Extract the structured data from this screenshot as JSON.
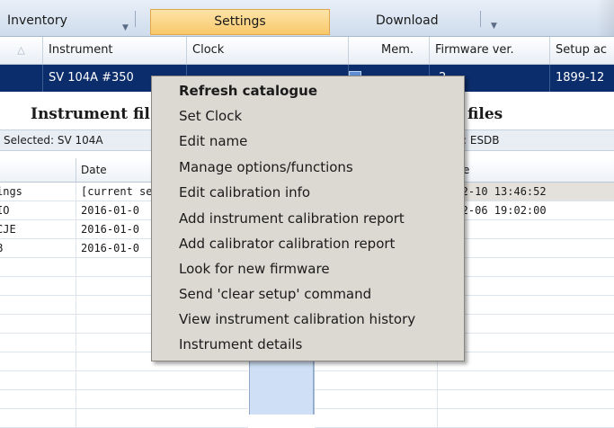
{
  "tabs": {
    "inventory": "Inventory",
    "settings": "Settings",
    "download": "Download"
  },
  "grid": {
    "headers": [
      "Instrument",
      "Clock",
      "Mem.",
      "Firmware ver.",
      "Setup ac"
    ],
    "row": {
      "instrument": "SV 104A #350",
      "clock": "",
      "mem": "",
      "firmware": ".2",
      "setup": "1899-12"
    }
  },
  "left_panel": {
    "title": "Instrument fil",
    "selected": "Selected: SV 104A",
    "columns": [
      "",
      "Date"
    ],
    "rows": [
      {
        "name": "ings",
        "date": "[current se"
      },
      {
        "name": "IO",
        "date": "2016-01-0"
      },
      {
        "name": "CJE",
        "date": "2016-01-0"
      },
      {
        "name": "B",
        "date": "2016-01-0"
      }
    ]
  },
  "right_panel": {
    "title": "files",
    "selected": ": ESDB",
    "columns": [
      "",
      "e"
    ],
    "rows": [
      {
        "date": "6-12-10 13:46:52"
      },
      {
        "date": "6-12-06 19:02:00"
      }
    ]
  },
  "context_menu": {
    "items": [
      "Refresh catalogue",
      "Set Clock",
      "Edit name",
      "Manage options/functions",
      "Edit calibration info",
      "Add instrument calibration report",
      "Add calibrator calibration report",
      "Look for new firmware",
      "Send 'clear setup' command",
      "View instrument calibration history",
      "Instrument details"
    ]
  }
}
